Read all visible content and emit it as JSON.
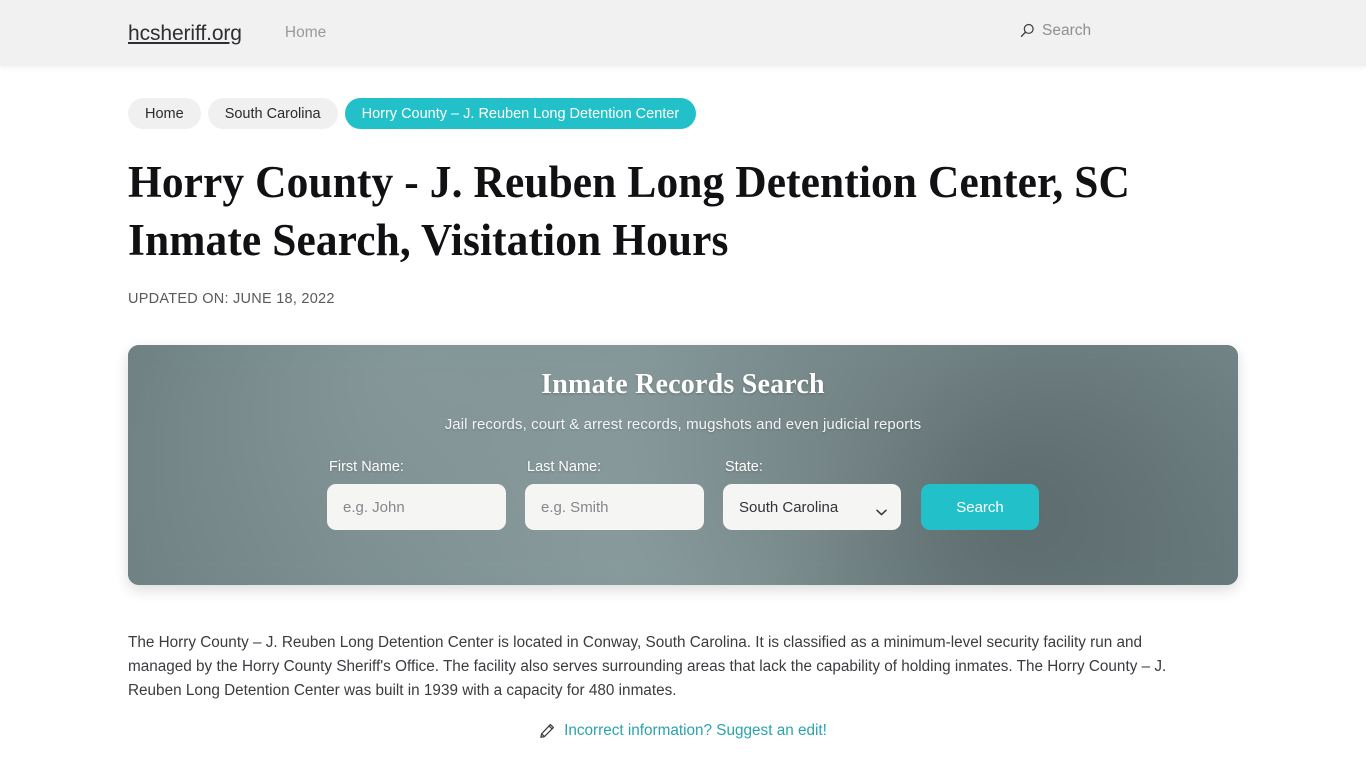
{
  "header": {
    "brand": "hcsheriff.org",
    "nav": [
      {
        "label": "Home"
      }
    ],
    "search_label": "Search",
    "search_icon": "search-icon"
  },
  "breadcrumbs": [
    {
      "label": "Home",
      "active": false
    },
    {
      "label": "South Carolina",
      "active": false
    },
    {
      "label": "Horry County – J. Reuben Long Detention Center",
      "active": true
    }
  ],
  "article": {
    "title": "Horry County - J. Reuben Long Detention Center, SC Inmate Search, Visitation Hours",
    "updated": "UPDATED ON: JUNE 18, 2022",
    "paragraph": "The Horry County – J. Reuben Long Detention Center is located in Conway, South Carolina. It is classified as a minimum-level security facility run and managed by the Horry County Sheriff's Office. The facility also serves surrounding areas that lack the capability of holding inmates. The Horry County – J. Reuben Long Detention Center was built in 1939 with a capacity for 480 inmates.",
    "suggest_link": "Incorrect information? Suggest an edit!",
    "suggest_icon": "pencil-icon"
  },
  "hero": {
    "title": "Inmate Records Search",
    "subtitle": "Jail records, court & arrest records, mugshots and even judicial reports",
    "fields": {
      "first_name": {
        "label": "First Name:",
        "value": "",
        "placeholder": "e.g. John"
      },
      "last_name": {
        "label": "Last Name:",
        "value": "",
        "placeholder": "e.g. Smith"
      },
      "state": {
        "label": "State:",
        "selected": "South Carolina",
        "options": [
          "South Carolina"
        ]
      }
    },
    "submit_label": "Search"
  },
  "colors": {
    "accent_teal": "#22c1c9",
    "link_teal": "#2aa3ae",
    "header_bg": "#f1f1f1",
    "crumb_bg": "#f0f0f0",
    "hero_bg": "#6f8083"
  }
}
